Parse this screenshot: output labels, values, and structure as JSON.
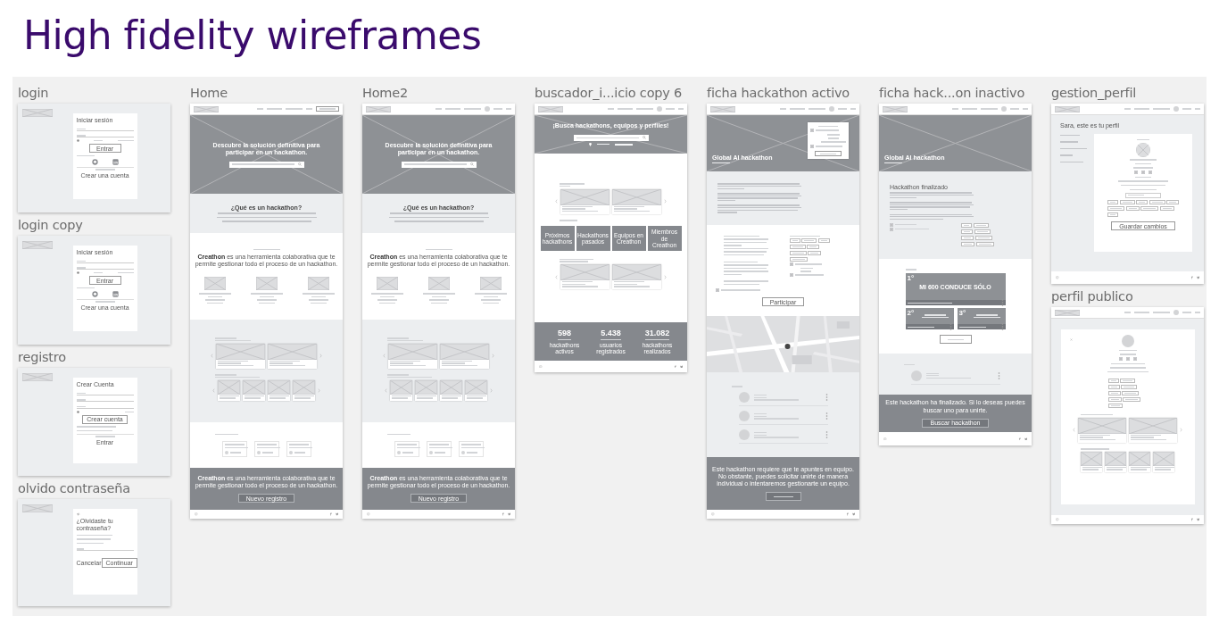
{
  "title": "High fidelity wireframes",
  "columns": [
    {
      "artboards": [
        {
          "label": "login",
          "sections": [
            {
              "kind": "login",
              "heading": "Iniciar sesión",
              "button": "Entrar",
              "link": "Crear una cuenta"
            }
          ]
        },
        {
          "label": "login copy",
          "sections": [
            {
              "kind": "login",
              "heading": "Iniciar sesión",
              "button": "Entrar",
              "link": "Crear una cuenta"
            }
          ]
        },
        {
          "label": "registro",
          "sections": [
            {
              "kind": "register",
              "heading": "Crear Cuenta",
              "button": "Crear cuenta",
              "link": "Entrar"
            }
          ]
        },
        {
          "label": "olvido contraseña",
          "sections": [
            {
              "kind": "forgot",
              "heading": "¿Olvidaste tu contraseña?",
              "buttons": [
                "Cancelar",
                "Continuar"
              ]
            }
          ]
        }
      ]
    },
    {
      "artboards": [
        {
          "label": "Home",
          "sections": [
            {
              "kind": "nav_guest"
            },
            {
              "kind": "hero_search",
              "heading": "Descubre la solución definitiva para participar en un hackathon."
            },
            {
              "kind": "text_band",
              "heading": "¿Qué es un hackathon?"
            },
            {
              "kind": "features",
              "statement": "**Creathon** es una herramienta colaborativa que te permite gestionar todo el proceso de un hackathon."
            },
            {
              "kind": "carousels"
            },
            {
              "kind": "tweets"
            },
            {
              "kind": "cta",
              "text": "**Creathon** es una herramienta colaborativa que te permite gestionar todo el proceso de un hackathon.",
              "button": "Nuevo registro"
            },
            {
              "kind": "footer"
            }
          ]
        }
      ]
    },
    {
      "artboards": [
        {
          "label": "Home2",
          "sections": [
            {
              "kind": "nav_user"
            },
            {
              "kind": "hero_search",
              "heading": "Descubre la solución definitiva para participar en un hackathon."
            },
            {
              "kind": "text_band",
              "heading": "¿Qué es un hackathon?"
            },
            {
              "kind": "features",
              "statement": "**Creathon** es una herramienta colaborativa que te permite gestionar todo el proceso de un hackathon."
            },
            {
              "kind": "carousels"
            },
            {
              "kind": "tweets"
            },
            {
              "kind": "cta",
              "text": "**Creathon** es una herramienta colaborativa que te permite gestionar todo el proceso de un hackathon.",
              "button": "Nuevo registro"
            },
            {
              "kind": "footer"
            }
          ]
        }
      ]
    },
    {
      "artboards": [
        {
          "label": "buscador_i...icio copy 6",
          "sections": [
            {
              "kind": "nav_user"
            },
            {
              "kind": "hero_finder",
              "heading": "¡Busca hackathons, equipos y perfiles!"
            },
            {
              "kind": "search_results",
              "tiles": [
                "Próximos hackathons",
                "Hackathons pasados",
                "Equipos en Creathon",
                "Miembros de Creathon"
              ]
            },
            {
              "kind": "stats",
              "items": [
                {
                  "value": "598",
                  "label": "hackathons activos"
                },
                {
                  "value": "5.438",
                  "label": "usuarios registrados"
                },
                {
                  "value": "31.082",
                  "label": "hackathons realizados"
                }
              ]
            },
            {
              "kind": "footer"
            }
          ]
        }
      ]
    },
    {
      "artboards": [
        {
          "label": "ficha hackathon activo",
          "sections": [
            {
              "kind": "nav_user"
            },
            {
              "kind": "hero_event_card",
              "heading": "Global AI hackathon"
            },
            {
              "kind": "event_desc"
            },
            {
              "kind": "event_info",
              "button": "Participar"
            },
            {
              "kind": "event_map"
            },
            {
              "kind": "people_list"
            },
            {
              "kind": "cta",
              "text": "Este hackathon requiere que te apuntes en equipo. No obstante, puedes solicitar unirte de manera individual o intentaremos gestionarte un equipo."
            },
            {
              "kind": "footer"
            }
          ]
        }
      ]
    },
    {
      "artboards": [
        {
          "label": "ficha hack...on inactivo",
          "sections": [
            {
              "kind": "nav_user"
            },
            {
              "kind": "hero_event",
              "heading": "Global AI hackathon"
            },
            {
              "kind": "result_band",
              "heading": "Hackathon finalizado"
            },
            {
              "kind": "podium",
              "entries": [
                {
                  "place": "1°",
                  "title": "MI 600 CONDUCE SÓLO"
                },
                {
                  "place": "2°"
                },
                {
                  "place": "3°"
                }
              ]
            },
            {
              "kind": "people_single"
            },
            {
              "kind": "cta",
              "text": "Este hackathon ha finalizado. Si lo deseas puedes buscar uno para unirte.",
              "button": "Buscar hackathon"
            },
            {
              "kind": "footer"
            }
          ]
        }
      ]
    },
    {
      "artboards": [
        {
          "label": "gestion_perfil",
          "sections": [
            {
              "kind": "nav_user"
            },
            {
              "kind": "profile_edit",
              "heading": "Sara, este es tu perfil",
              "button": "Guardar cambios"
            },
            {
              "kind": "footer"
            }
          ]
        },
        {
          "label": "perfil publico",
          "sections": [
            {
              "kind": "nav_user"
            },
            {
              "kind": "profile_public"
            },
            {
              "kind": "footer"
            }
          ]
        }
      ]
    }
  ]
}
